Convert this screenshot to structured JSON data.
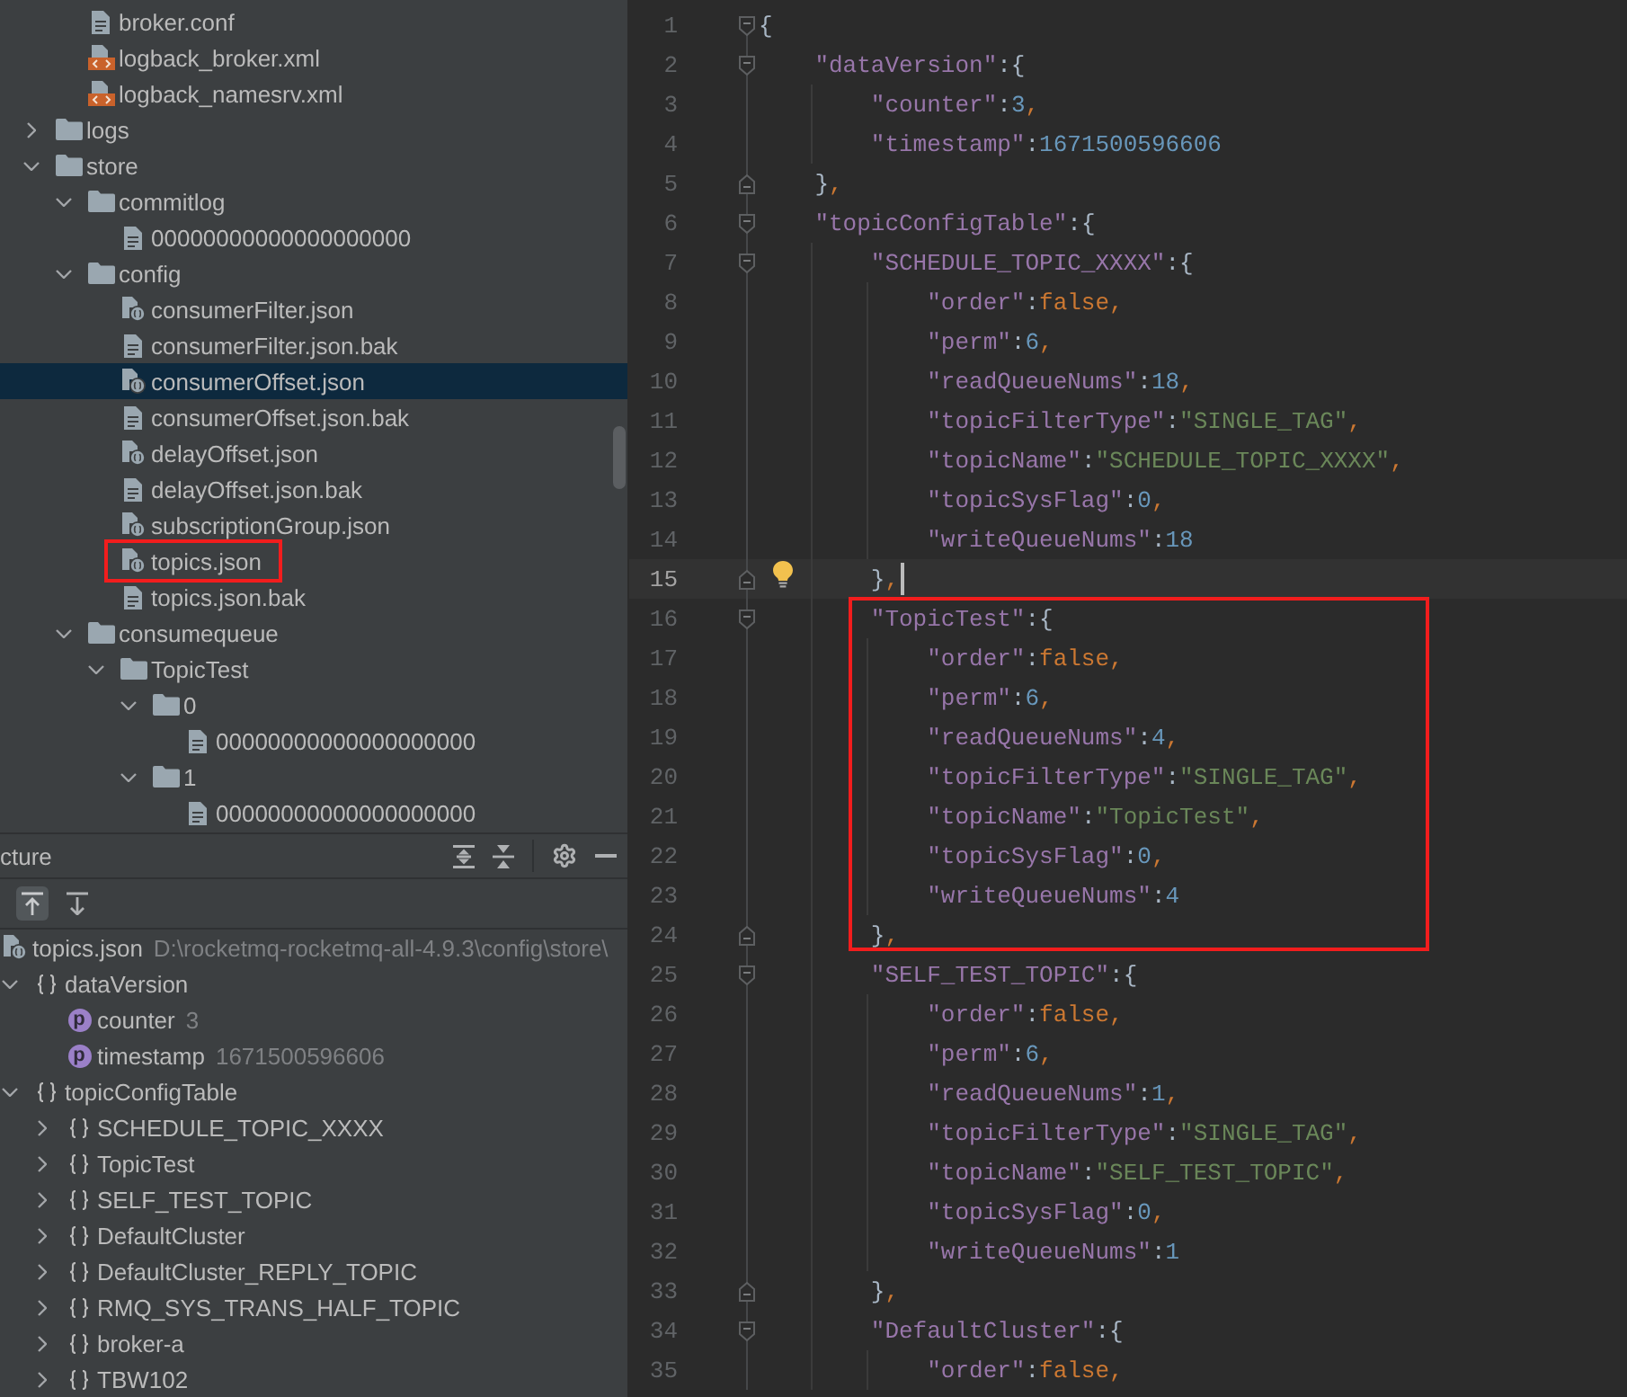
{
  "project_tree": {
    "items": [
      {
        "children": [
          {
            "label": "broker.conf",
            "kind": "text",
            "selected": false,
            "marked": false
          },
          {
            "label": "logback_broker.xml",
            "kind": "xml",
            "selected": false,
            "marked": false
          },
          {
            "label": "logback_namesrv.xml",
            "kind": "xml",
            "selected": false,
            "marked": false
          }
        ]
      },
      {
        "label": "logs",
        "kind": "folder",
        "expanded": false,
        "selected": false,
        "marked": false
      },
      {
        "label": "store",
        "kind": "folder",
        "expanded": true,
        "selected": false,
        "marked": false,
        "children": [
          {
            "label": "commitlog",
            "kind": "folder",
            "expanded": true,
            "selected": false,
            "marked": false,
            "children": [
              {
                "label": "00000000000000000000",
                "kind": "text",
                "selected": false,
                "marked": false
              }
            ]
          },
          {
            "label": "config",
            "kind": "folder",
            "expanded": true,
            "selected": false,
            "marked": false,
            "children": [
              {
                "label": "consumerFilter.json",
                "kind": "json",
                "selected": false,
                "marked": false
              },
              {
                "label": "consumerFilter.json.bak",
                "kind": "text",
                "selected": false,
                "marked": false
              },
              {
                "label": "consumerOffset.json",
                "kind": "json",
                "selected": true,
                "marked": false
              },
              {
                "label": "consumerOffset.json.bak",
                "kind": "text",
                "selected": false,
                "marked": false
              },
              {
                "label": "delayOffset.json",
                "kind": "json",
                "selected": false,
                "marked": false
              },
              {
                "label": "delayOffset.json.bak",
                "kind": "text",
                "selected": false,
                "marked": false
              },
              {
                "label": "subscriptionGroup.json",
                "kind": "json",
                "selected": false,
                "marked": false
              },
              {
                "label": "topics.json",
                "kind": "json",
                "selected": false,
                "marked": true
              },
              {
                "label": "topics.json.bak",
                "kind": "text",
                "selected": false,
                "marked": false
              }
            ]
          },
          {
            "label": "consumequeue",
            "kind": "folder",
            "expanded": true,
            "selected": false,
            "marked": false,
            "children": [
              {
                "label": "TopicTest",
                "kind": "folder",
                "expanded": true,
                "selected": false,
                "marked": false,
                "children": [
                  {
                    "label": "0",
                    "kind": "folder",
                    "expanded": true,
                    "selected": false,
                    "marked": false,
                    "children": [
                      {
                        "label": "00000000000000000000",
                        "kind": "text",
                        "selected": false,
                        "marked": false
                      }
                    ]
                  },
                  {
                    "label": "1",
                    "kind": "folder",
                    "expanded": true,
                    "selected": false,
                    "marked": false,
                    "children": [
                      {
                        "label": "00000000000000000000",
                        "kind": "text",
                        "selected": false,
                        "marked": false
                      }
                    ]
                  }
                ]
              }
            ]
          }
        ]
      }
    ]
  },
  "structure": {
    "title": "cture",
    "toggles": [
      {
        "kind": "to-top",
        "on": true
      },
      {
        "kind": "from-top",
        "on": false
      }
    ],
    "items": [
      {
        "label": "topics.json",
        "kind": "file",
        "detail": "D:\\rocketmq-rocketmq-all-4.9.3\\config\\store\\",
        "selected": false,
        "children": [
          {
            "label": "dataVersion",
            "kind": "object",
            "expanded": true,
            "selected": false,
            "children": [
              {
                "label": "counter",
                "kind": "property",
                "badge": "p",
                "detail": "3",
                "selected": false
              },
              {
                "label": "timestamp",
                "kind": "property",
                "badge": "p",
                "detail": "1671500596606",
                "selected": false
              }
            ]
          },
          {
            "label": "topicConfigTable",
            "kind": "object",
            "expanded": true,
            "selected": false,
            "children": [
              {
                "label": "SCHEDULE_TOPIC_XXXX",
                "kind": "object",
                "expanded": false,
                "selected": false
              },
              {
                "label": "TopicTest",
                "kind": "object",
                "expanded": false,
                "selected": false
              },
              {
                "label": "SELF_TEST_TOPIC",
                "kind": "object",
                "expanded": false,
                "selected": false
              },
              {
                "label": "DefaultCluster",
                "kind": "object",
                "expanded": false,
                "selected": false
              },
              {
                "label": "DefaultCluster_REPLY_TOPIC",
                "kind": "object",
                "expanded": false,
                "selected": false
              },
              {
                "label": "RMQ_SYS_TRANS_HALF_TOPIC",
                "kind": "object",
                "expanded": false,
                "selected": false
              },
              {
                "label": "broker-a",
                "kind": "object",
                "expanded": false,
                "selected": false
              },
              {
                "label": "TBW102",
                "kind": "object",
                "expanded": false,
                "selected": false
              }
            ]
          }
        ]
      }
    ]
  },
  "editor": {
    "blocks": [
      {
        "framed": false,
        "lines": [
          {
            "number": "1",
            "text": "{",
            "kind": "open",
            "current": false
          },
          {
            "number": "2",
            "text": "    \"dataVersion\":{",
            "kind": "open",
            "current": false
          },
          {
            "number": "3",
            "text": "        \"counter\":3,",
            "kind": "plain",
            "current": false
          },
          {
            "number": "4",
            "text": "        \"timestamp\":1671500596606",
            "kind": "plain",
            "current": false
          },
          {
            "number": "5",
            "text": "    },",
            "kind": "close",
            "current": false
          },
          {
            "number": "6",
            "text": "    \"topicConfigTable\":{",
            "kind": "open",
            "current": false
          },
          {
            "number": "7",
            "text": "        \"SCHEDULE_TOPIC_XXXX\":{",
            "kind": "open",
            "current": false
          },
          {
            "number": "8",
            "text": "            \"order\":false,",
            "kind": "plain",
            "current": false
          },
          {
            "number": "9",
            "text": "            \"perm\":6,",
            "kind": "plain",
            "current": false
          },
          {
            "number": "10",
            "text": "            \"readQueueNums\":18,",
            "kind": "plain",
            "current": false
          },
          {
            "number": "11",
            "text": "            \"topicFilterType\":\"SINGLE_TAG\",",
            "kind": "plain",
            "current": false
          },
          {
            "number": "12",
            "text": "            \"topicName\":\"SCHEDULE_TOPIC_XXXX\",",
            "kind": "plain",
            "current": false
          },
          {
            "number": "13",
            "text": "            \"topicSysFlag\":0,",
            "kind": "plain",
            "current": false
          },
          {
            "number": "14",
            "text": "            \"writeQueueNums\":18",
            "kind": "plain",
            "current": false
          },
          {
            "number": "15",
            "text": "        },",
            "kind": "close",
            "current": true
          }
        ]
      },
      {
        "framed": true,
        "lines": [
          {
            "number": "16",
            "text": "        \"TopicTest\":{",
            "kind": "open",
            "current": false
          },
          {
            "number": "17",
            "text": "            \"order\":false,",
            "kind": "plain",
            "current": false
          },
          {
            "number": "18",
            "text": "            \"perm\":6,",
            "kind": "plain",
            "current": false
          },
          {
            "number": "19",
            "text": "            \"readQueueNums\":4,",
            "kind": "plain",
            "current": false
          },
          {
            "number": "20",
            "text": "            \"topicFilterType\":\"SINGLE_TAG\",",
            "kind": "plain",
            "current": false
          },
          {
            "number": "21",
            "text": "            \"topicName\":\"TopicTest\",",
            "kind": "plain",
            "current": false
          },
          {
            "number": "22",
            "text": "            \"topicSysFlag\":0,",
            "kind": "plain",
            "current": false
          },
          {
            "number": "23",
            "text": "            \"writeQueueNums\":4",
            "kind": "plain",
            "current": false
          },
          {
            "number": "24",
            "text": "        },",
            "kind": "close",
            "current": false
          }
        ]
      },
      {
        "framed": false,
        "lines": [
          {
            "number": "25",
            "text": "        \"SELF_TEST_TOPIC\":{",
            "kind": "open",
            "current": false
          },
          {
            "number": "26",
            "text": "            \"order\":false,",
            "kind": "plain",
            "current": false
          },
          {
            "number": "27",
            "text": "            \"perm\":6,",
            "kind": "plain",
            "current": false
          },
          {
            "number": "28",
            "text": "            \"readQueueNums\":1,",
            "kind": "plain",
            "current": false
          },
          {
            "number": "29",
            "text": "            \"topicFilterType\":\"SINGLE_TAG\",",
            "kind": "plain",
            "current": false
          },
          {
            "number": "30",
            "text": "            \"topicName\":\"SELF_TEST_TOPIC\",",
            "kind": "plain",
            "current": false
          },
          {
            "number": "31",
            "text": "            \"topicSysFlag\":0,",
            "kind": "plain",
            "current": false
          },
          {
            "number": "32",
            "text": "            \"writeQueueNums\":1",
            "kind": "plain",
            "current": false
          },
          {
            "number": "33",
            "text": "        },",
            "kind": "close",
            "current": false
          },
          {
            "number": "34",
            "text": "        \"DefaultCluster\":{",
            "kind": "open",
            "current": false
          },
          {
            "number": "35",
            "text": "            \"order\":false,",
            "kind": "plain",
            "current": false
          }
        ]
      }
    ]
  }
}
